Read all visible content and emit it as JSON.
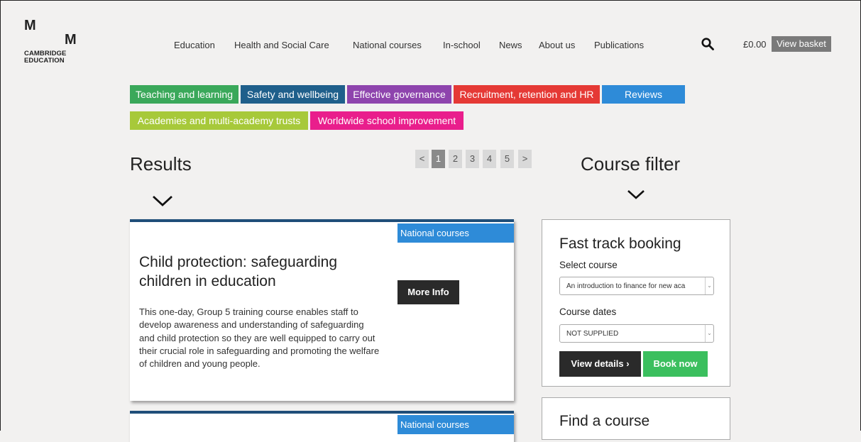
{
  "logo": {
    "line1": "M",
    "line2": "M",
    "line3": "CAMBRIDGE",
    "line4": "EDUCATION"
  },
  "nav": {
    "items": [
      "Education",
      "Health and Social Care",
      "National courses",
      "In-school",
      "News",
      "About us",
      "Publications"
    ],
    "basket_amount": "£0.00",
    "basket_label": "View basket"
  },
  "tags": [
    {
      "label": "Teaching and learning",
      "color": "#3aa85a"
    },
    {
      "label": "Safety and wellbeing",
      "color": "#1f5f8b"
    },
    {
      "label": "Effective governance",
      "color": "#8e44ad"
    },
    {
      "label": "Recruitment, retention and HR",
      "color": "#e53935"
    },
    {
      "label": "Reviews",
      "color": "#2e8bd8"
    },
    {
      "label": "Academies and multi-academy trusts",
      "color": "#a7c93a"
    },
    {
      "label": "Worldwide school improvement",
      "color": "#e91e8c"
    }
  ],
  "results": {
    "heading": "Results",
    "pagination": [
      "<",
      "1",
      "2",
      "3",
      "4",
      "5",
      ">"
    ],
    "active_page": "1",
    "cards": [
      {
        "badge": "National courses",
        "title": "Child protection: safeguarding children in education",
        "description": "This one-day, Group 5 training course enables staff to develop awareness and understanding of safeguarding and child protection so they are well equipped to carry out their crucial role in safeguarding and promoting the welfare of children and young people.",
        "button": "More Info"
      },
      {
        "badge": "National courses"
      }
    ]
  },
  "filter": {
    "heading": "Course filter",
    "fast_track": {
      "title": "Fast track booking",
      "select_course_label": "Select course",
      "select_course_value": "An introduction to finance for new aca",
      "course_dates_label": "Course dates",
      "course_dates_value": "NOT SUPPLIED",
      "details_button": "View details ›",
      "book_button": "Book now"
    },
    "find_course": {
      "title": "Find a course"
    }
  }
}
